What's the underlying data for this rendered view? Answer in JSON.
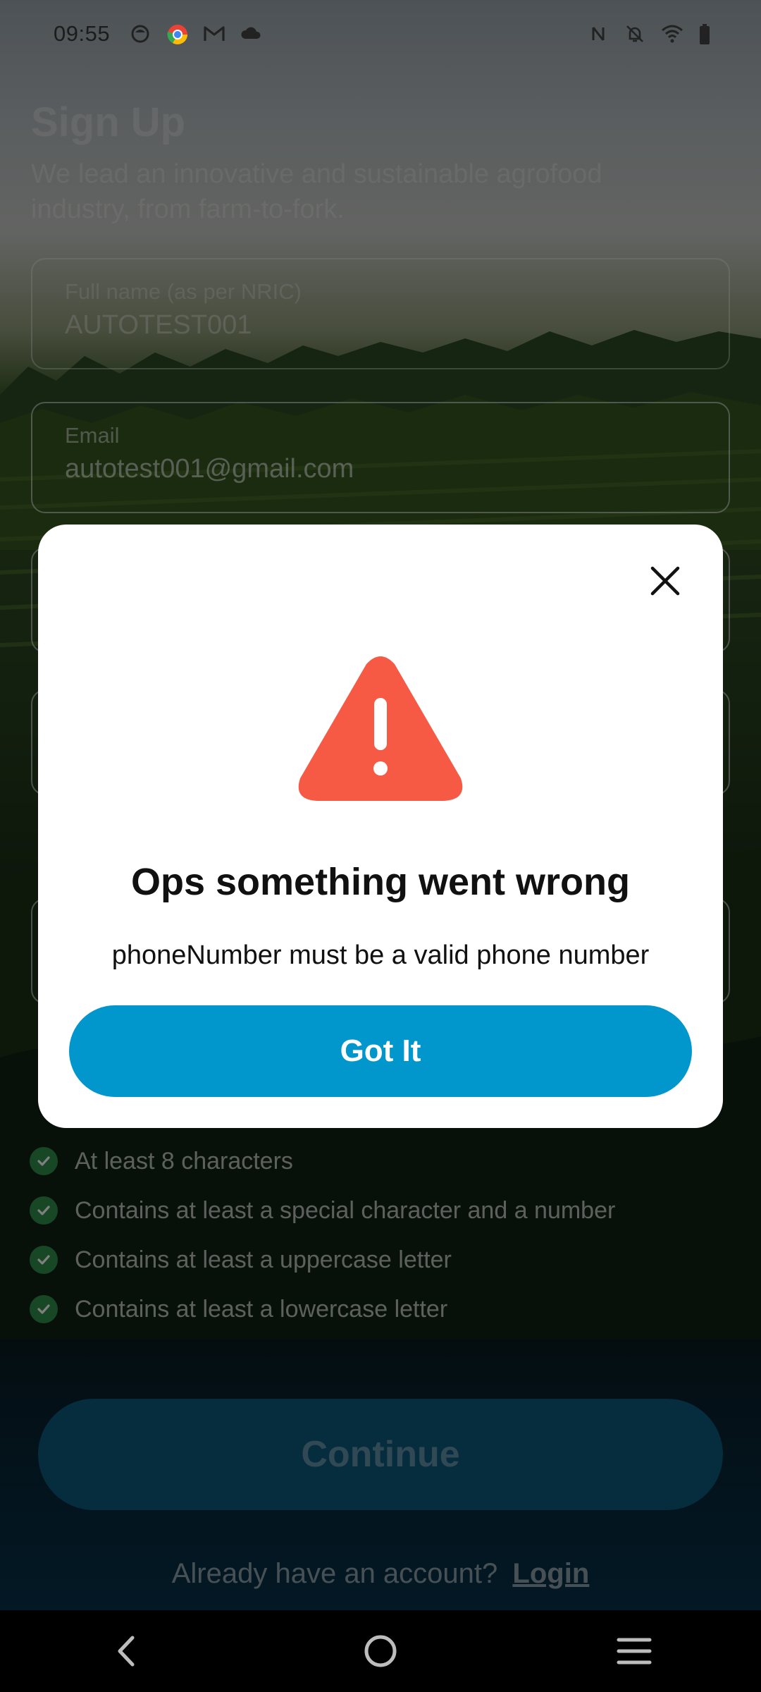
{
  "status_bar": {
    "time": "09:55",
    "left_icons": [
      "app-icon",
      "chrome-icon",
      "gmail-icon",
      "cloud-icon"
    ],
    "right_icons": [
      "nfc-icon",
      "bell-off-icon",
      "wifi-icon",
      "battery-icon"
    ]
  },
  "form": {
    "title": "Sign Up",
    "subtitle": "We lead an innovative and sustainable agrofood industry, from farm-to-fork.",
    "full_name": {
      "label": "Full name (as per NRIC)",
      "value": "AUTOTEST001"
    },
    "email": {
      "label": "Email",
      "value": "autotest001@gmail.com"
    },
    "password_rules": [
      "At least 8 characters",
      "Contains at least a special character and a number",
      "Contains at least a uppercase letter",
      "Contains at least a lowercase letter"
    ],
    "continue_label": "Continue",
    "login_prompt": "Already have an account?",
    "login_link": "Login"
  },
  "dialog": {
    "title": "Ops something went wrong",
    "message": "phoneNumber must be a valid phone number",
    "button_label": "Got It",
    "icon": "warning-icon",
    "accent_color": "#0297cc",
    "warning_color": "#f65a44"
  },
  "nav": {
    "icons": [
      "back-icon",
      "home-icon",
      "menu-icon"
    ]
  }
}
